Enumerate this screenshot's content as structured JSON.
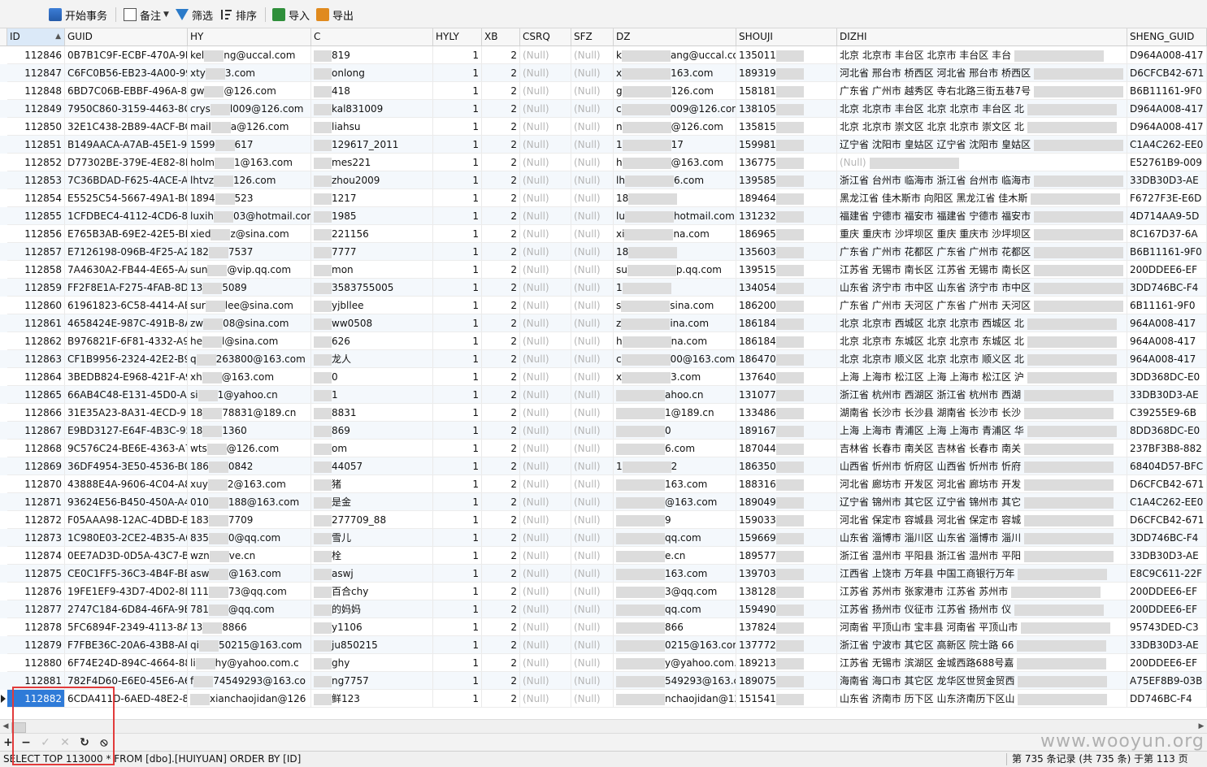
{
  "toolbar": {
    "begin_tx": "开始事务",
    "note": "备注",
    "filter": "筛选",
    "sort": "排序",
    "import": "导入",
    "export": "导出"
  },
  "columns": [
    {
      "key": "id",
      "label": "ID"
    },
    {
      "key": "guid",
      "label": "GUID"
    },
    {
      "key": "hy",
      "label": "HY"
    },
    {
      "key": "c",
      "label": "C"
    },
    {
      "key": "hyly",
      "label": "HYLY"
    },
    {
      "key": "xb",
      "label": "XB"
    },
    {
      "key": "csrq",
      "label": "CSRQ"
    },
    {
      "key": "sfz",
      "label": "SFZ"
    },
    {
      "key": "dz",
      "label": "DZ"
    },
    {
      "key": "shouji",
      "label": "SHOUJI"
    },
    {
      "key": "dizhi",
      "label": "DIZHI"
    },
    {
      "key": "sheng",
      "label": "SHENG_GUID"
    }
  ],
  "null_text": "(Null)",
  "rows": [
    [
      "112846",
      "0B7B1C9F-ECBF-470A-9F9",
      "kel",
      "ng@uccal.com",
      "819",
      "1",
      "2",
      "k",
      "ang@uccal.com",
      "135011",
      "北京 北京市 丰台区 北",
      "京市 丰台区 丰台",
      "D964A008-417"
    ],
    [
      "112847",
      "C6FC0B56-EB23-4A00-99E",
      "xty",
      "3.com",
      "onlong",
      "1",
      "2",
      "x",
      "163.com",
      "189319",
      "河北省 邢台市 桥西区 河北省 邢台市 桥西区",
      "",
      "D6CFCB42-671"
    ],
    [
      "112848",
      "6BD7C06B-EBBF-496A-88",
      "gw",
      "@126.com",
      "418",
      "1",
      "2",
      "g",
      "126.com",
      "158181",
      "广东省 广州市 越秀区 寺右北路三街五巷7号",
      "",
      "B6B11161-9F0"
    ],
    [
      "112849",
      "7950C860-3159-4463-8C6",
      "crys",
      "l009@126.com",
      "kal831009",
      "1",
      "2",
      "c",
      "009@126.com",
      "138105",
      "北京 北京市 丰台区 北京 北京市 丰台区 北",
      "",
      "D964A008-417"
    ],
    [
      "112850",
      "32E1C438-2B89-4ACF-BC",
      "mail",
      "a@126.com",
      "liahsu",
      "1",
      "2",
      "n",
      "@126.com",
      "135815",
      "北京 北京市 崇文区 北京 北京市 崇文区 北",
      "",
      "D964A008-417"
    ],
    [
      "112851",
      "B149AACA-A7AB-45E1-93",
      "1599",
      "617",
      "129617_2011",
      "1",
      "2",
      "1",
      "17",
      "159981",
      "辽宁省 沈阳市 皇姑区 辽宁省 沈阳市 皇姑区",
      "",
      "C1A4C262-EE0"
    ],
    [
      "112852",
      "D77302BE-379E-4E82-8E",
      "holm",
      "1@163.com",
      "mes221",
      "1",
      "2",
      "h",
      "@163.com",
      "136775",
      "(Null)",
      "",
      "E52761B9-009"
    ],
    [
      "112853",
      "7C36BDAD-F625-4ACE-A9",
      "lhtvz",
      "126.com",
      "zhou2009",
      "1",
      "2",
      "lh",
      "6.com",
      "139585",
      "浙江省 台州市 临海市 浙江省 台州市 临海市",
      "",
      "33DB30D3-AE"
    ],
    [
      "112854",
      "E5525C54-5667-49A1-B0",
      "1894",
      "523",
      "1217",
      "1",
      "2",
      "18",
      "",
      "189464",
      "黑龙江省 佳木斯市 向阳区 黑龙江省 佳木斯",
      "",
      "F6727F3E-E6D"
    ],
    [
      "112855",
      "1CFDBEC4-4112-4CD6-85",
      "luxih",
      "03@hotmail.com",
      "1985",
      "1",
      "2",
      "lu",
      "hotmail.com",
      "131232",
      "福建省 宁德市 福安市 福建省 宁德市 福安市",
      "",
      "4D714AA9-5D"
    ],
    [
      "112856",
      "E765B3AB-69E2-42E5-BB",
      "xied",
      "z@sina.com",
      "221156",
      "1",
      "2",
      "xi",
      "na.com",
      "186965",
      "重庆 重庆市 沙坪坝区 重庆 重庆市 沙坪坝区",
      "",
      "8C167D37-6A"
    ],
    [
      "112857",
      "E7126198-096B-4F25-A21",
      "182",
      "7537",
      "7777",
      "1",
      "2",
      "18",
      "",
      "135603",
      "广东省 广州市 花都区 广东省 广州市 花都区",
      "",
      "B6B11161-9F0"
    ],
    [
      "112858",
      "7A4630A2-FB44-4E65-AA",
      "sun",
      "@vip.qq.com",
      "mon",
      "1",
      "2",
      "su",
      "p.qq.com",
      "139515",
      "江苏省 无锡市 南长区 江苏省 无锡市 南长区",
      "",
      "200DDEE6-EF"
    ],
    [
      "112859",
      "FF2F8E1A-F275-4FAB-8DB",
      "13",
      "5089",
      "3583755005",
      "1",
      "2",
      "1",
      "",
      "134054",
      "山东省 济宁市 市中区 山东省 济宁市 市中区",
      "",
      "3DD746BC-F4"
    ],
    [
      "112860",
      "61961823-6C58-4414-AB5",
      "sur",
      "lee@sina.com",
      "yjbllee",
      "1",
      "2",
      "s",
      "sina.com",
      "186200",
      "广东省 广州市 天河区 广东省 广州市 天河区",
      "",
      "6B11161-9F0"
    ],
    [
      "112861",
      "4658424E-987C-491B-8A7",
      "zw",
      "08@sina.com",
      "ww0508",
      "1",
      "2",
      "z",
      "ina.com",
      "186184",
      "北京 北京市 西城区 北京 北京市 西城区 北",
      "",
      "964A008-417"
    ],
    [
      "112862",
      "B976821F-6F81-4332-A90",
      "he",
      "l@sina.com",
      "626",
      "1",
      "2",
      "h",
      "na.com",
      "186184",
      "北京 北京市 东城区 北京 北京市 东城区 北",
      "",
      "964A008-417"
    ],
    [
      "112863",
      "CF1B9956-2324-42E2-B95",
      "q",
      "263800@163.com",
      "龙人",
      "1",
      "2",
      "c",
      "00@163.com",
      "186470",
      "北京 北京市 顺义区 北京 北京市 顺义区 北",
      "",
      "964A008-417"
    ],
    [
      "112864",
      "3BEDB824-E968-421F-A9",
      "xh",
      "@163.com",
      "0",
      "1",
      "2",
      "x",
      "3.com",
      "137640",
      "上海 上海市 松江区 上海 上海市 松江区 沪",
      "",
      "3DD368DC-E0"
    ],
    [
      "112865",
      "66AB4C48-E131-45D0-A5",
      "si",
      "1@yahoo.cn",
      "1",
      "1",
      "2",
      "",
      "ahoo.cn",
      "131077",
      "浙江省 杭州市 西湖区 浙江省 杭州市 西湖",
      "",
      "33DB30D3-AE"
    ],
    [
      "112866",
      "31E35A23-8A31-4ECD-92",
      "18",
      "78831@189.cn",
      "8831",
      "1",
      "2",
      "",
      "1@189.cn",
      "133486",
      "湖南省 长沙市 长沙县 湖南省 长沙市 长沙",
      "",
      "C39255E9-6B"
    ],
    [
      "112867",
      "E9BD3127-E64F-4B3C-95",
      "18",
      "1360",
      "869",
      "1",
      "2",
      "",
      "0",
      "189167",
      "上海 上海市 青浦区 上海 上海市 青浦区 华",
      "",
      "8DD368DC-E0"
    ],
    [
      "112868",
      "9C576C24-BE6E-4363-A7",
      "wts",
      "@126.com",
      "om",
      "1",
      "2",
      "",
      "6.com",
      "187044",
      "吉林省 长春市 南关区 吉林省 长春市 南关",
      "",
      "237BF3B8-882"
    ],
    [
      "112869",
      "36DF4954-3E50-4536-B08",
      "186",
      "0842",
      "44057",
      "1",
      "2",
      "1",
      "2",
      "186350",
      "山西省 忻州市 忻府区 山西省 忻州市 忻府",
      "",
      "68404D57-BFC"
    ],
    [
      "112870",
      "43888E4A-9606-4C04-A8",
      "xuy",
      "2@163.com",
      "猪",
      "1",
      "2",
      "",
      "163.com",
      "188316",
      "河北省 廊坊市 开发区 河北省 廊坊市 开发",
      "",
      "D6CFCB42-671"
    ],
    [
      "112871",
      "93624E56-B450-450A-A4",
      "010",
      "188@163.com",
      "是金",
      "1",
      "2",
      "",
      "@163.com",
      "189049",
      "辽宁省 锦州市 其它区 辽宁省 锦州市 其它",
      "",
      "C1A4C262-EE0"
    ],
    [
      "112872",
      "F05AAA98-12AC-4DBD-B",
      "183",
      "7709",
      "277709_88",
      "1",
      "2",
      "",
      "9",
      "159033",
      "河北省 保定市 容城县 河北省 保定市 容城",
      "",
      "D6CFCB42-671"
    ],
    [
      "112873",
      "1C980E03-2CE2-4B35-A6",
      "835",
      "0@qq.com",
      "雪儿",
      "1",
      "2",
      "",
      "qq.com",
      "159669",
      "山东省 淄博市 淄川区 山东省 淄博市 淄川",
      "",
      "3DD746BC-F4"
    ],
    [
      "112874",
      "0EE7AD3D-0D5A-43C7-B9",
      "wzn",
      "ve.cn",
      "栓",
      "1",
      "2",
      "",
      "e.cn",
      "189577",
      "浙江省 温州市 平阳县 浙江省 温州市 平阳",
      "",
      "33DB30D3-AE"
    ],
    [
      "112875",
      "CE0C1FF5-36C3-4B4F-BE8",
      "asw",
      "@163.com",
      "aswj",
      "1",
      "2",
      "",
      "163.com",
      "139703",
      "江西省 上饶市 万年县 中国工商银行万年",
      "",
      "E8C9C611-22F"
    ],
    [
      "112876",
      "19FE1EF9-43D7-4D02-8D",
      "111",
      "73@qq.com",
      "百合chy",
      "1",
      "2",
      "",
      "3@qq.com",
      "138128",
      "江苏省 苏州市 张家港市 江苏省 苏州市",
      "",
      "200DDEE6-EF"
    ],
    [
      "112877",
      "2747C184-6D84-46FA-9B",
      "781",
      "@qq.com",
      "的妈妈",
      "1",
      "2",
      "",
      "qq.com",
      "159490",
      "江苏省 扬州市 仪征市 江苏省 扬州市 仪",
      "",
      "200DDEE6-EF"
    ],
    [
      "112878",
      "5FC6894F-2349-4113-8AE",
      "13",
      "8866",
      "y1106",
      "1",
      "2",
      "",
      "866",
      "137824",
      "河南省 平顶山市 宝丰县 河南省 平顶山市",
      "",
      "95743DED-C3"
    ],
    [
      "112879",
      "F7FBE36C-20A6-43B8-AFE",
      "qi",
      "50215@163.com",
      "ju850215",
      "1",
      "2",
      "",
      "0215@163.com",
      "137772",
      "浙江省 宁波市 其它区 高新区 院士路 66",
      "",
      "33DB30D3-AE"
    ],
    [
      "112880",
      "6F74E24D-894C-4664-88",
      "li",
      "hy@yahoo.com.c",
      "ghy",
      "1",
      "2",
      "",
      "y@yahoo.com.cn",
      "189213",
      "江苏省 无锡市 滨湖区 金城西路688号嘉",
      "",
      "200DDEE6-EF"
    ],
    [
      "112881",
      "782F4D60-E6E0-45E6-A66",
      "f",
      "74549293@163.co",
      "ng7757",
      "1",
      "2",
      "",
      "549293@163.co",
      "189075",
      "海南省 海口市 其它区 龙华区世贸金贸西",
      "",
      "A75EF8B9-03B"
    ],
    [
      "112882",
      "6CDA411D-6AED-48E2-82",
      "",
      "xianchaojidan@126",
      "鲜123",
      "1",
      "2",
      "",
      "nchaojidan@126.",
      "151541",
      "山东省 济南市 历下区 山东济南历下区山",
      "",
      "DD746BC-F4"
    ]
  ],
  "status": {
    "sql": "SELECT TOP 113000  * FROM [dbo].[HUIYUAN] ORDER BY [ID]",
    "info": "第 735 条记录 (共 735 条) 于第 113 页"
  },
  "watermark": "www.wooyun.org"
}
